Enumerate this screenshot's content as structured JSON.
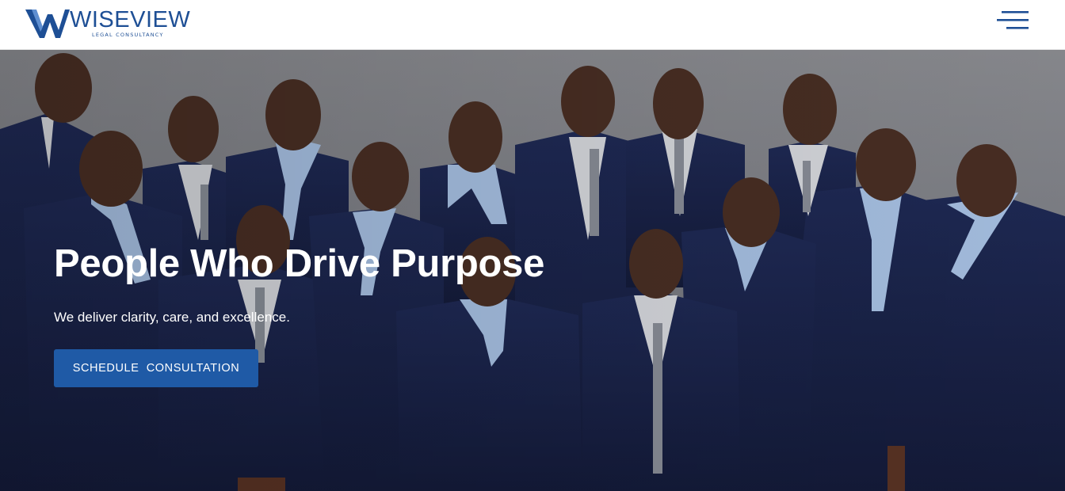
{
  "header": {
    "brand_name": "WISEVIEW",
    "brand_tagline": "LEGAL CONSULTANCY",
    "menu_icon": "hamburger-menu-icon"
  },
  "hero": {
    "title": "People Who Drive Purpose",
    "subtitle": "We deliver clarity, care, and excellence.",
    "cta_label": "SCHEDULE  CONSULTATION",
    "image_alt": "Team group photo"
  },
  "colors": {
    "brand_blue": "#1e4f95",
    "cta_blue": "#1f5aa6",
    "suit_navy": "#1a2550",
    "header_bg": "#ffffff"
  }
}
